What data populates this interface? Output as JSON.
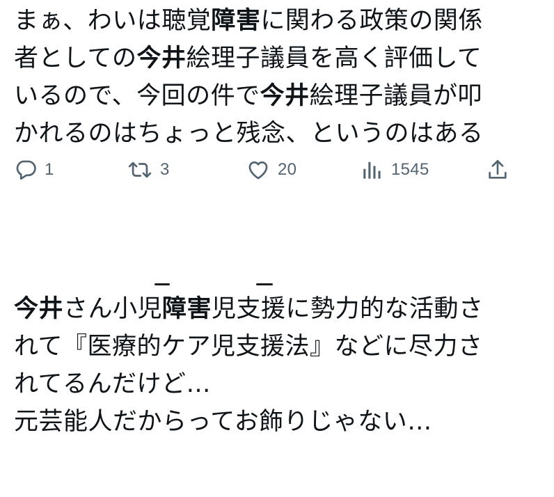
{
  "tweet1": {
    "lines": [
      [
        {
          "t": "まぁ、わいは聴覚",
          "b": false
        },
        {
          "t": "障害",
          "b": true
        },
        {
          "t": "に関わる政策の関係",
          "b": false
        }
      ],
      [
        {
          "t": "者としての",
          "b": false
        },
        {
          "t": "今井",
          "b": true
        },
        {
          "t": "絵理子議員を高く評価して",
          "b": false
        }
      ],
      [
        {
          "t": "いるので、今回の件で",
          "b": false
        },
        {
          "t": "今井",
          "b": true
        },
        {
          "t": "絵理子議員が叩",
          "b": false
        }
      ],
      [
        {
          "t": "かれるのはちょっと残念、というのはある",
          "b": false
        }
      ]
    ],
    "actions": {
      "replies": "1",
      "retweets": "3",
      "likes": "20",
      "views": "1545"
    }
  },
  "tweet2": {
    "lines": [
      [
        {
          "t": "今井",
          "b": true
        },
        {
          "t": "さん小児",
          "b": false
        },
        {
          "t": "障害",
          "b": true
        },
        {
          "t": "児支援に勢力的な活動さ",
          "b": false
        }
      ],
      [
        {
          "t": "れて『医療的ケア児支援法』などに尽力さ",
          "b": false
        }
      ],
      [
        {
          "t": "れてるんだけど…",
          "b": false
        }
      ],
      [
        {
          "t": "元芸能人だからってお飾りじゃない…",
          "b": false
        }
      ]
    ]
  },
  "icons": {
    "reply": "reply-icon",
    "retweet": "retweet-icon",
    "like": "heart-icon",
    "views": "views-icon",
    "share": "share-icon"
  },
  "colors": {
    "text": "#0f1419",
    "secondary": "#536471"
  }
}
